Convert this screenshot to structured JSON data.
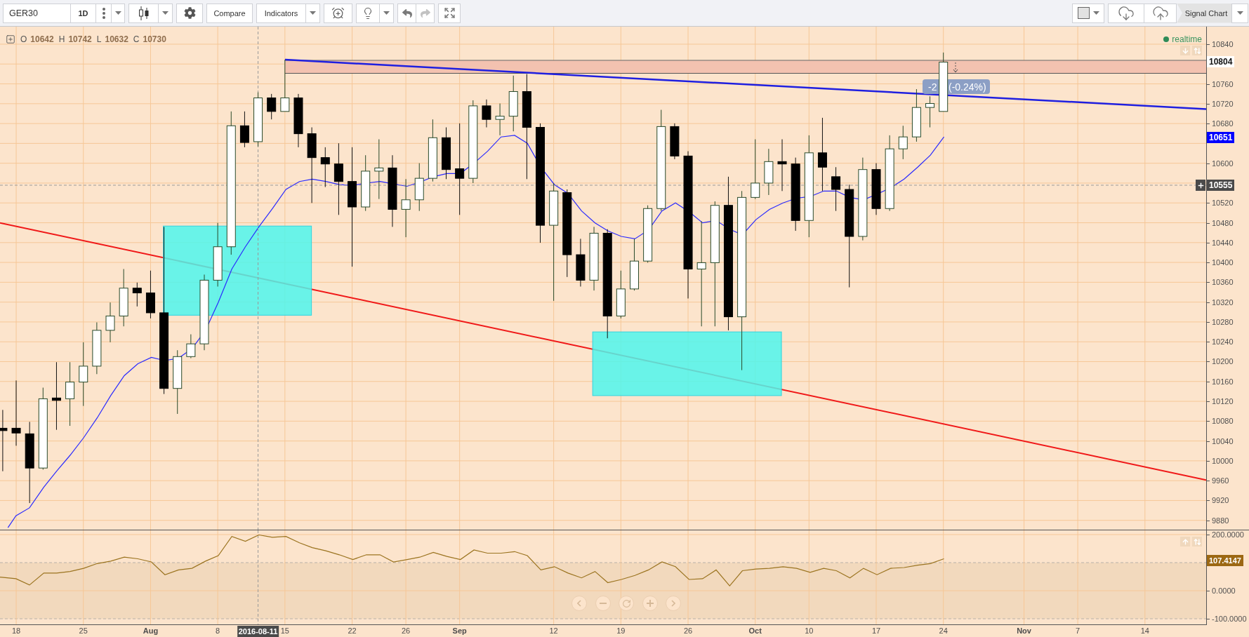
{
  "toolbar": {
    "symbol_field": {
      "value": "GER30"
    },
    "interval": "1D",
    "compare": "Compare",
    "indicators": "Indicators",
    "history": [
      {
        "kind": "undo",
        "disabled": false
      },
      {
        "kind": "redo",
        "disabled": true
      }
    ],
    "layout_name": "Signal Chart"
  },
  "legend": [
    {
      "key": "O",
      "value": "10642"
    },
    {
      "key": "H",
      "value": "10742"
    },
    {
      "key": "L",
      "value": "10632"
    },
    {
      "key": "C",
      "value": "10730"
    }
  ],
  "status": "realtime",
  "price_change": [
    "-2",
    "(-0.24%)"
  ],
  "price_axis": {
    "labels": [
      "10840",
      "10760",
      "10720",
      "10680",
      "10600",
      "10520",
      "10480",
      "10440",
      "10400",
      "10360",
      "10320",
      "10280",
      "10240",
      "10200",
      "10160",
      "10120",
      "10080",
      "10040",
      "10000",
      "9960",
      "9920",
      "9880"
    ],
    "markers": [
      {
        "kind": "last_price",
        "label": "10804",
        "color": "#ffffff"
      },
      {
        "kind": "indicator",
        "label": "10651",
        "color": "#0000ff"
      },
      {
        "kind": "crosshair",
        "label": "10555",
        "color": "#4a4a4a"
      }
    ]
  },
  "oscillator": {
    "axis_labels": [
      "200.0000",
      "0.0000",
      "-100.0000"
    ],
    "marker": {
      "label": "107.4147",
      "color": "#9c6813"
    }
  },
  "time_axis": {
    "labels": [
      {
        "label": "18",
        "kind": "day"
      },
      {
        "label": "25",
        "kind": "day"
      },
      {
        "label": "Aug",
        "kind": "month"
      },
      {
        "label": "8",
        "kind": "day"
      },
      {
        "label": "15",
        "kind": "day"
      },
      {
        "label": "22",
        "kind": "day"
      },
      {
        "label": "26",
        "kind": "day"
      },
      {
        "label": "Sep",
        "kind": "month"
      },
      {
        "label": "12",
        "kind": "day"
      },
      {
        "label": "19",
        "kind": "day"
      },
      {
        "label": "26",
        "kind": "day"
      },
      {
        "label": "Oct",
        "kind": "month"
      },
      {
        "label": "10",
        "kind": "day"
      },
      {
        "label": "17",
        "kind": "day"
      },
      {
        "label": "24",
        "kind": "day"
      },
      {
        "label": "Nov",
        "kind": "month"
      },
      {
        "label": "7",
        "kind": "day"
      },
      {
        "label": "14",
        "kind": "day"
      }
    ],
    "crosshair_label": "2016-08-11"
  }
}
